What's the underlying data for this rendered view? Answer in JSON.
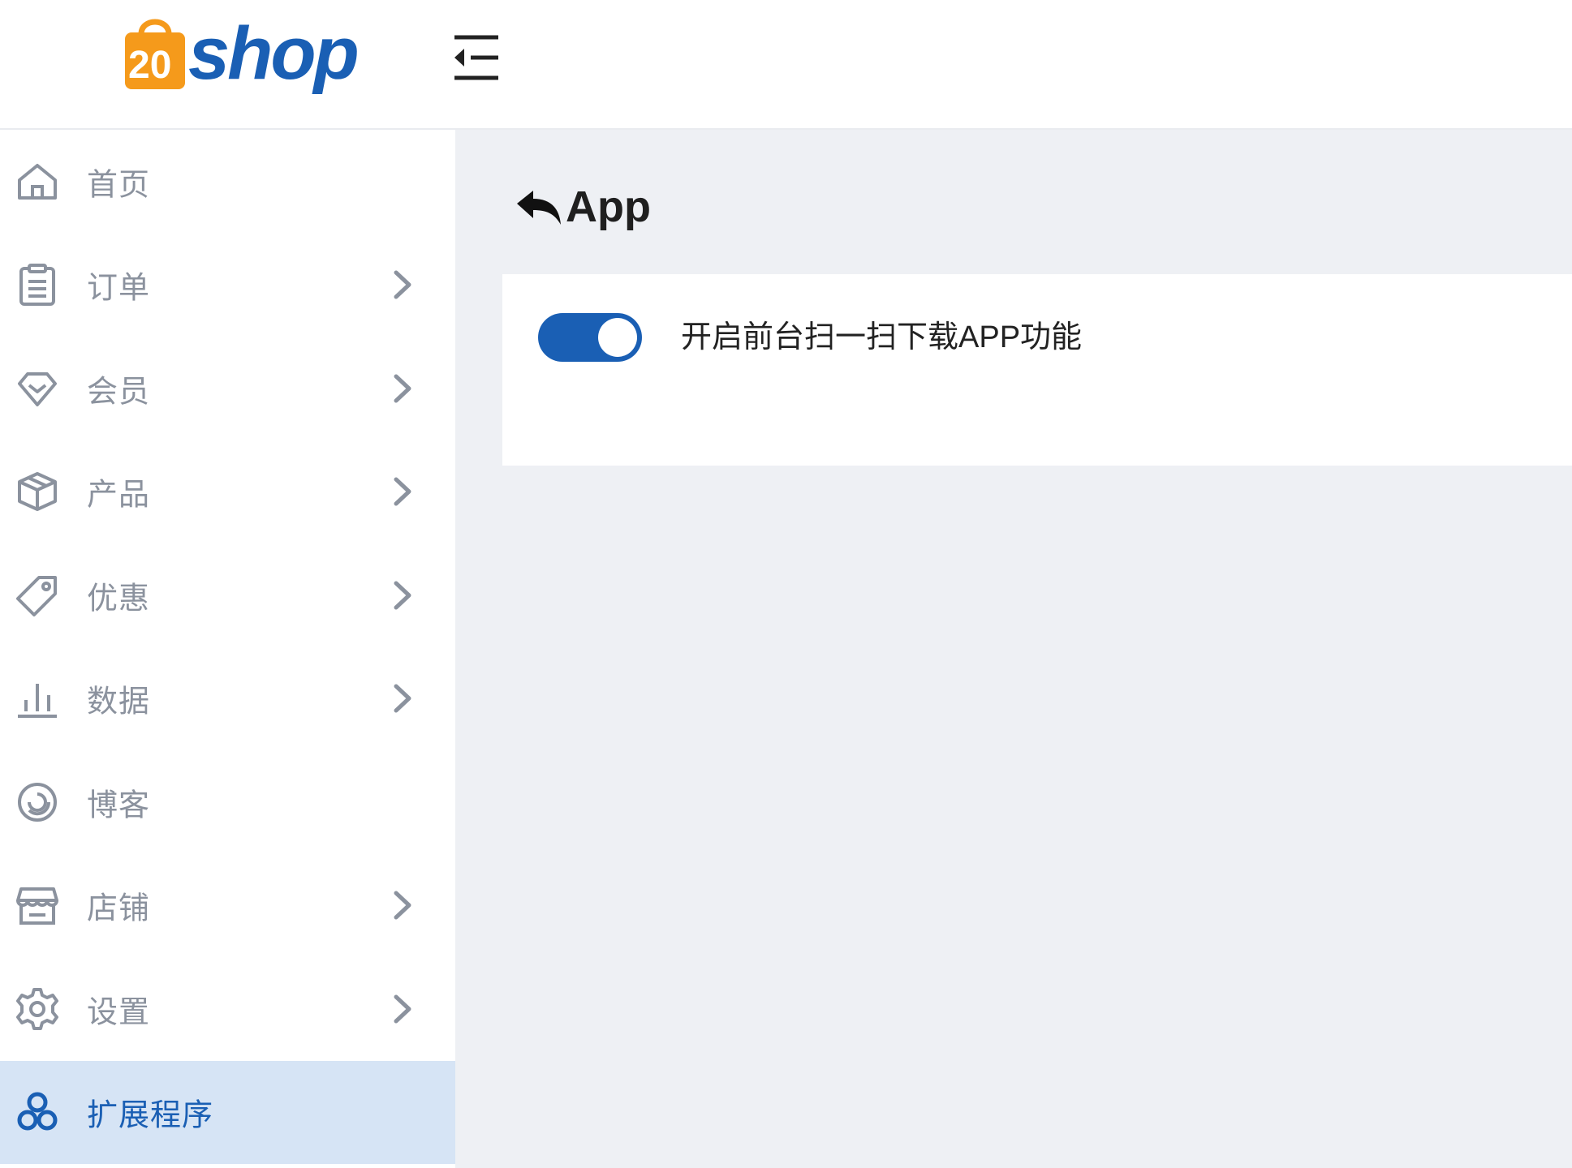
{
  "brand": {
    "logo_text": "shop",
    "logo_badge": "20",
    "accent_color": "#1a5fb4",
    "logo_orange": "#f59a1b"
  },
  "header": {
    "menu_toggle_icon": "menu-collapse-icon"
  },
  "sidebar": {
    "items": [
      {
        "label": "首页",
        "icon": "home-icon",
        "has_children": false,
        "active": false
      },
      {
        "label": "订单",
        "icon": "clipboard-icon",
        "has_children": true,
        "active": false
      },
      {
        "label": "会员",
        "icon": "diamond-icon",
        "has_children": true,
        "active": false
      },
      {
        "label": "产品",
        "icon": "box-icon",
        "has_children": true,
        "active": false
      },
      {
        "label": "优惠",
        "icon": "tag-icon",
        "has_children": true,
        "active": false
      },
      {
        "label": "数据",
        "icon": "bar-chart-icon",
        "has_children": true,
        "active": false
      },
      {
        "label": "博客",
        "icon": "target-icon",
        "has_children": false,
        "active": false
      },
      {
        "label": "店铺",
        "icon": "store-icon",
        "has_children": true,
        "active": false
      },
      {
        "label": "设置",
        "icon": "gear-icon",
        "has_children": true,
        "active": false
      },
      {
        "label": "扩展程序",
        "icon": "extensions-icon",
        "has_children": false,
        "active": true
      }
    ]
  },
  "main": {
    "title": "App",
    "back_icon": "back-arrow-icon",
    "settings": {
      "toggle_label": "开启前台扫一扫下载APP功能",
      "toggle_on": true
    }
  }
}
